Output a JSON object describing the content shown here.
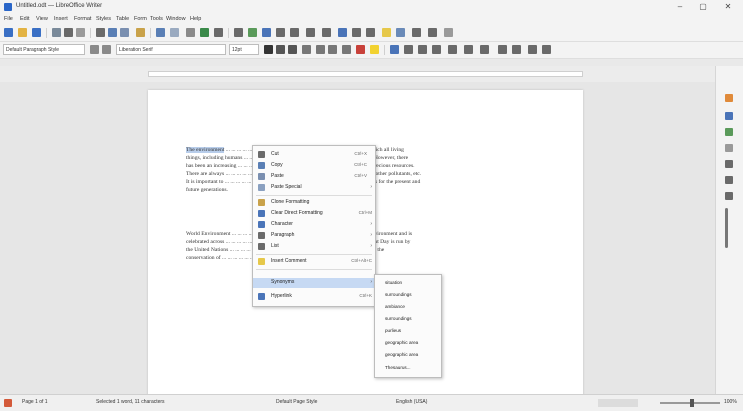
{
  "window": {
    "title": "Untitled.odt — LibreOffice Writer",
    "minimize": "–",
    "maximize": "▢",
    "close": "✕"
  },
  "menubar": [
    "File",
    "Edit",
    "View",
    "Insert",
    "Format",
    "Styles",
    "Table",
    "Form",
    "Tools",
    "Window",
    "Help"
  ],
  "formatting": {
    "paragraph_style": "Default Paragraph Style",
    "font_name": "Liberation Serif",
    "font_size": "12pt"
  },
  "document": {
    "para1": [
      {
        "pre": "",
        "sel": "The environment",
        "post": " ... ... ... ... ... ... ... ... ...  is the natural world in which we live and which all living"
      },
      {
        "pre": "things, including humans ... ... ... ... ... ... ... ... ... ...  resources from the environment. However, there",
        "sel": "",
        "post": ""
      },
      {
        "pre": "has been an increasing ... ... ... ... ... ... ... ... ... ... ...  depletion and pollution of these precious resources.",
        "sel": "",
        "post": ""
      },
      {
        "pre": "There are always ... ... ... ... ... ... ... ... ... ... ... ... ...  issues related to air and water and other pollutants, etc.",
        "sel": "",
        "post": ""
      },
      {
        "pre": "It is important to ... ... ... ... ... ... ... ... ... ... ... ... ...  preserve and protect such resources for the present and",
        "sel": "",
        "post": ""
      },
      {
        "pre": "future generations.",
        "sel": "",
        "post": ""
      }
    ],
    "para2": [
      "World Environment ... ... ... ... ... ... ... ... ... ... ...  awareness towards protecting the environment and is",
      "celebrated across ... ... ... ... ... ... ... ... ... ... ... ... ...  every year. The World Environment Day is run by",
      "the United Nations ... ... ... ... ... ... ... ... ... ... ... ...  platform to spread awareness about the",
      "conservation of ... ... ... ... ... ... ... ... ... ... ... ... ..."
    ]
  },
  "context_menu": {
    "items": [
      {
        "label": "Cut",
        "shortcut": "Ctrl+X",
        "icon": "scissors-icon",
        "color": "#6a6a6a"
      },
      {
        "label": "Copy",
        "shortcut": "Ctrl+C",
        "icon": "copy-icon",
        "color": "#5a7fb5"
      },
      {
        "label": "Paste",
        "shortcut": "Ctrl+V",
        "icon": "paste-icon",
        "color": "#7a8fb0"
      },
      {
        "label": "Paste Special",
        "shortcut": "",
        "icon": "paste-special-icon",
        "color": "#8aa0c0",
        "submenu": true
      },
      {
        "label": "Clone Formatting",
        "shortcut": "",
        "icon": "paintbrush-icon",
        "color": "#c9a24a"
      },
      {
        "label": "Clear Direct Formatting",
        "shortcut": "Ctrl+M",
        "icon": "clear-format-icon",
        "color": "#4a74b8"
      },
      {
        "label": "Character",
        "shortcut": "",
        "icon": "character-icon",
        "color": "#4a74b8",
        "submenu": true
      },
      {
        "label": "Paragraph",
        "shortcut": "",
        "icon": "paragraph-icon",
        "color": "#6a6a6a",
        "submenu": true
      },
      {
        "label": "List",
        "shortcut": "",
        "icon": "list-icon",
        "color": "#6a6a6a",
        "submenu": true
      },
      {
        "label": "Insert Comment",
        "shortcut": "Ctrl+Alt+C",
        "icon": "comment-icon",
        "color": "#e6c84a"
      },
      {
        "label": "Synonyms",
        "shortcut": "",
        "icon": "",
        "color": "",
        "submenu": true,
        "highlighted": true
      },
      {
        "label": "Hyperlink",
        "shortcut": "Ctrl+K",
        "icon": "hyperlink-icon",
        "color": "#4a74b8"
      }
    ]
  },
  "synonyms_submenu": [
    "situation",
    "surroundings",
    "ambiance",
    "surroundings",
    "purlieus",
    "geographic area",
    "geographic area",
    "Thesaurus..."
  ],
  "statusbar": {
    "page": "Page 1 of 1",
    "words": "Selected 1 word, 11 characters",
    "page_style": "Default Page Style",
    "language": "English (USA)",
    "zoom": "100%"
  }
}
